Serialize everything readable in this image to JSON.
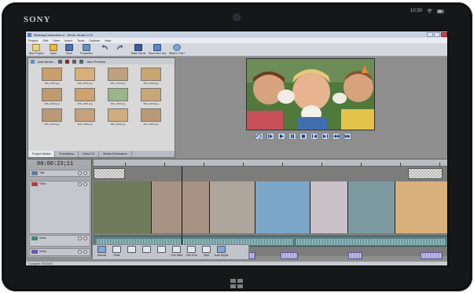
{
  "device": {
    "brand": "SONY",
    "status_icons": [
      "wifi-icon",
      "battery-icon",
      "signal-icon"
    ],
    "status_time": "10:30"
  },
  "window": {
    "title": "BirthdayCelebration.vf - Movie Studio 13.0",
    "buttons": [
      "minimize",
      "maximize",
      "close"
    ]
  },
  "menu": [
    "Project",
    "Edit",
    "View",
    "Insert",
    "Tools",
    "Options",
    "Help"
  ],
  "toolbar": {
    "items": [
      {
        "label": "New Project",
        "icon": "new-project-icon",
        "color": "#e7d48a"
      },
      {
        "label": "Open",
        "icon": "folder-open-icon",
        "color": "#e6b64f"
      },
      {
        "label": "Save",
        "icon": "save-icon",
        "color": "#4f6eab"
      },
      {
        "label": "Properties",
        "icon": "properties-icon",
        "color": "#6b8db6"
      },
      {
        "label": "",
        "icon": "undo-icon",
        "color": "#5e6b7c"
      },
      {
        "label": "",
        "icon": "redo-icon",
        "color": "#5e6b7c"
      },
      {
        "label": "Make Movie",
        "icon": "make-movie-icon",
        "color": "#3d5f96"
      },
      {
        "label": "Show Me How",
        "icon": "show-me-how-icon",
        "color": "#5a86c6"
      },
      {
        "label": "What's This?",
        "icon": "help-icon",
        "color": "#7ea3d6"
      }
    ]
  },
  "media_panel": {
    "toolbar_label": "Add Media...",
    "auto_preview_label": "Auto Preview",
    "thumbnails": [
      {
        "caption": "IMG_0011.jpg",
        "color": "#c9a06b"
      },
      {
        "caption": "IMG_0012.jpg",
        "color": "#d7b077"
      },
      {
        "caption": "IMG_0013.jpg",
        "color": "#bfa180"
      },
      {
        "caption": "IMG_0014.jpg",
        "color": "#c8a66d"
      },
      {
        "caption": "IMG_0020.jpg",
        "color": "#c09b6e"
      },
      {
        "caption": "IMG_0021.jpg",
        "color": "#cfa270"
      },
      {
        "caption": "IMG_0022.jpg",
        "color": "#9bb58a"
      },
      {
        "caption": "IMG_0023.jpg",
        "color": "#c8a777"
      },
      {
        "caption": "IMG_0024.jpg",
        "color": "#b99a74"
      },
      {
        "caption": "IMG_0025.jpg",
        "color": "#c5a27a"
      },
      {
        "caption": "IMG_0026.jpg",
        "color": "#d0ad80"
      },
      {
        "caption": "IMG_0027.jpg",
        "color": "#b99a74"
      }
    ],
    "tabs": [
      {
        "label": "Project Media",
        "active": true
      },
      {
        "label": "Transitions",
        "active": false
      },
      {
        "label": "Video FX",
        "active": false
      },
      {
        "label": "Media Generators",
        "active": false
      }
    ]
  },
  "preview": {
    "transport_buttons": [
      "loop-icon",
      "play-from-start-icon",
      "play-icon",
      "pause-icon",
      "stop-icon",
      "previous-frame-icon",
      "next-frame-icon",
      "go-to-start-icon",
      "go-to-end-icon"
    ]
  },
  "timeline": {
    "timecode": "00:00:23;11",
    "tracks": [
      {
        "name": "Title",
        "kind": "text"
      },
      {
        "name": "Video",
        "kind": "video"
      },
      {
        "name": "Audio",
        "kind": "audio"
      },
      {
        "name": "Music",
        "kind": "music"
      }
    ],
    "clip_colors": [
      "#6e7a5a",
      "#a79283",
      "#b0a59a",
      "#7da7c9",
      "#c9c0c8",
      "#7d9aa1",
      "#d8b07a"
    ],
    "bottom_tools": [
      {
        "label": "Normal",
        "icon": "normal-edit-icon",
        "active": true
      },
      {
        "label": "Fade",
        "icon": "fade-icon",
        "active": false
      },
      {
        "label": "",
        "icon": "split-audio-icon",
        "active": false
      },
      {
        "label": "",
        "icon": "crop-icon",
        "active": false
      },
      {
        "label": "",
        "icon": "delete-icon",
        "active": false
      },
      {
        "label": "Trim Start",
        "icon": "trim-start-icon",
        "active": false
      },
      {
        "label": "Trim End",
        "icon": "trim-end-icon",
        "active": false
      },
      {
        "label": "Split",
        "icon": "split-icon",
        "active": false
      },
      {
        "label": "Auto Ripple",
        "icon": "auto-ripple-icon",
        "active": true
      }
    ]
  },
  "statusbar": {
    "text": "Complete: 00:00:00"
  }
}
